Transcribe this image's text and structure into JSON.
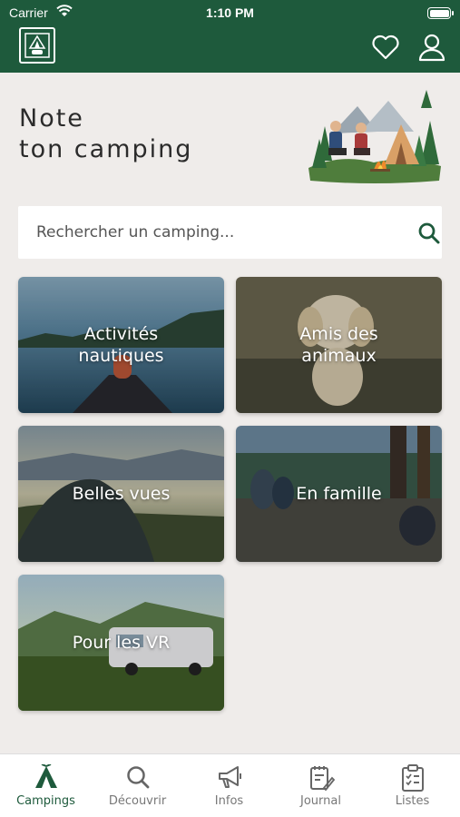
{
  "status": {
    "carrier": "Carrier",
    "time": "1:10 PM"
  },
  "header": {
    "logo": "camping-logo-icon",
    "actions": [
      "heart-icon",
      "user-icon"
    ]
  },
  "headline": {
    "line1": "Note",
    "line2": "ton camping"
  },
  "search": {
    "placeholder": "Rechercher un camping..."
  },
  "categories": [
    {
      "label": "Activités\nnautiques"
    },
    {
      "label": "Amis des\nanimaux"
    },
    {
      "label": "Belles vues"
    },
    {
      "label": "En famille"
    },
    {
      "label": "Pour les VR"
    }
  ],
  "tabs": [
    {
      "label": "Campings",
      "icon": "tent-icon",
      "active": true
    },
    {
      "label": "Découvrir",
      "icon": "search-icon"
    },
    {
      "label": "Infos",
      "icon": "megaphone-icon"
    },
    {
      "label": "Journal",
      "icon": "journal-icon"
    },
    {
      "label": "Listes",
      "icon": "checklist-icon"
    }
  ],
  "colors": {
    "primary": "#1e5a3c",
    "background": "#efecea"
  }
}
